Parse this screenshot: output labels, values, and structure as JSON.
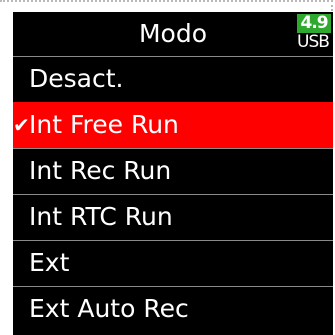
{
  "header": {
    "title": "Modo",
    "battery_level": "4.9",
    "battery_source": "USB"
  },
  "menu": {
    "items": [
      {
        "label": "Desact.",
        "selected": false
      },
      {
        "label": "Int Free Run",
        "selected": true
      },
      {
        "label": "Int Rec Run",
        "selected": false
      },
      {
        "label": "Int RTC Run",
        "selected": false
      },
      {
        "label": "Ext",
        "selected": false
      },
      {
        "label": "Ext Auto Rec",
        "selected": false
      }
    ],
    "check_glyph": "✔"
  },
  "colors": {
    "background": "#000000",
    "highlight": "#ff0000",
    "battery": "#2ea82e",
    "text": "#ffffff"
  }
}
